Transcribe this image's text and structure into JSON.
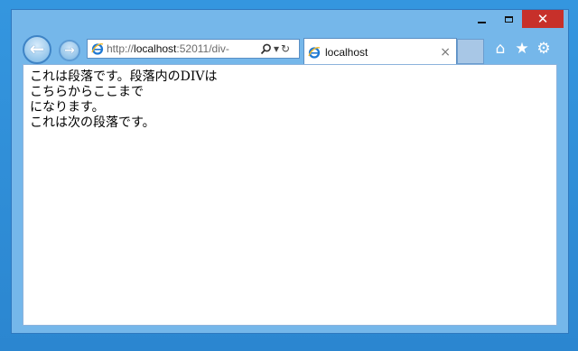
{
  "window": {
    "caption": {
      "minimize": "",
      "maximize": "",
      "close": "✕"
    }
  },
  "nav": {
    "back_icon": "back-arrow-icon",
    "forward_icon": "forward-arrow-icon"
  },
  "address": {
    "scheme": "http://",
    "host": "localhost",
    "rest": ":52011/div-",
    "search_icon": "search-icon",
    "dropdown": "▾",
    "refresh": "↻"
  },
  "tab": {
    "label": "localhost",
    "close": "×"
  },
  "toolbar": {
    "home": "⌂",
    "favorites": "★",
    "tools": "⚙"
  },
  "page": {
    "lines": [
      "これは段落です。段落内のDIVは",
      "こちらからここまで",
      "になります。",
      "これは次の段落です。"
    ]
  },
  "colors": {
    "desktop": "#2f8fd8",
    "frame": "#75b7ea",
    "close_button": "#c7302a"
  }
}
